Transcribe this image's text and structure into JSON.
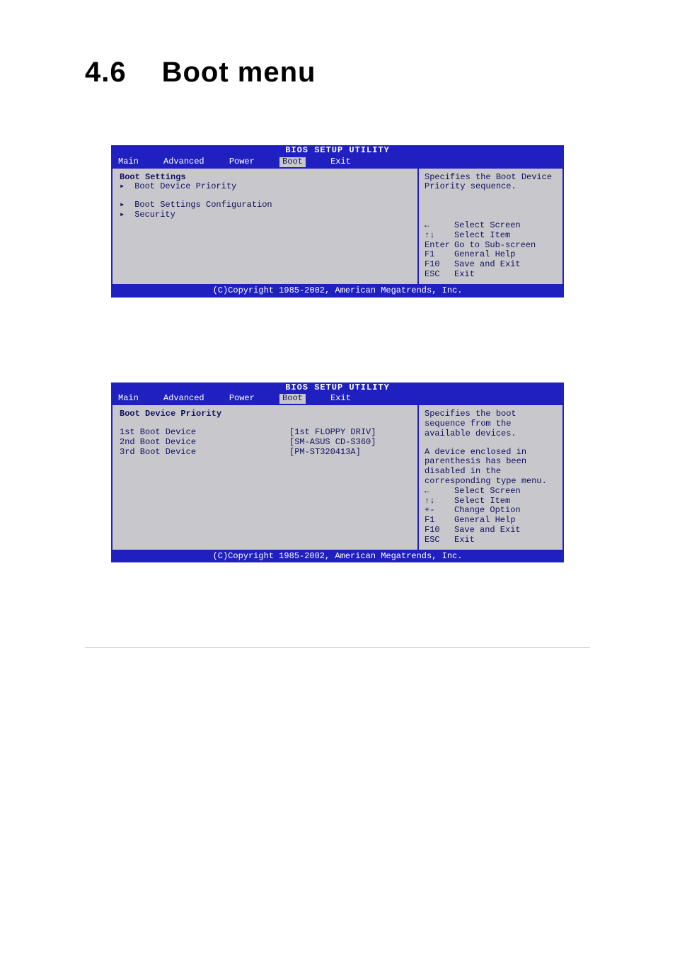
{
  "heading": {
    "number": "4.6",
    "title": "Boot menu"
  },
  "bios_title": "BIOS SETUP UTILITY",
  "tabs": {
    "main": "Main",
    "advanced": "Advanced",
    "power": "Power",
    "boot": "Boot",
    "exit": "Exit"
  },
  "copyright": "(C)Copyright 1985-2002, American Megatrends, Inc.",
  "screen1": {
    "section_header": "Boot Settings",
    "items": {
      "0": "Boot Device Priority",
      "1": "Boot Settings Configuration",
      "2": "Security"
    },
    "help_text": "Specifies the Boot Device Priority sequence.",
    "keys": {
      "lr": {
        "sym": "←",
        "label": "Select Screen"
      },
      "ud": {
        "sym": "↑↓",
        "label": "Select Item"
      },
      "enter": {
        "sym": "Enter",
        "label": "Go to Sub-screen"
      },
      "f1": {
        "sym": "F1",
        "label": "General Help"
      },
      "f10": {
        "sym": "F10",
        "label": "Save and Exit"
      },
      "esc": {
        "sym": "ESC",
        "label": "Exit"
      }
    }
  },
  "screen2": {
    "section_header": "Boot Device Priority",
    "items": {
      "0": {
        "label": "1st Boot Device",
        "value": "[1st FLOPPY DRIV]"
      },
      "1": {
        "label": "2nd Boot Device",
        "value": "[SM-ASUS CD-S360]"
      },
      "2": {
        "label": "3rd Boot Device",
        "value": "[PM-ST320413A]"
      }
    },
    "help_text1": "Specifies the boot sequence from the available devices.",
    "help_text2": "A device enclosed in parenthesis has been disabled in the corresponding type menu.",
    "keys": {
      "lr": {
        "sym": "←",
        "label": "Select Screen"
      },
      "ud": {
        "sym": "↑↓",
        "label": "Select Item"
      },
      "pm": {
        "sym": "+-",
        "label": "Change Option"
      },
      "f1": {
        "sym": "F1",
        "label": "General Help"
      },
      "f10": {
        "sym": "F10",
        "label": "Save and Exit"
      },
      "esc": {
        "sym": "ESC",
        "label": "Exit"
      }
    }
  }
}
